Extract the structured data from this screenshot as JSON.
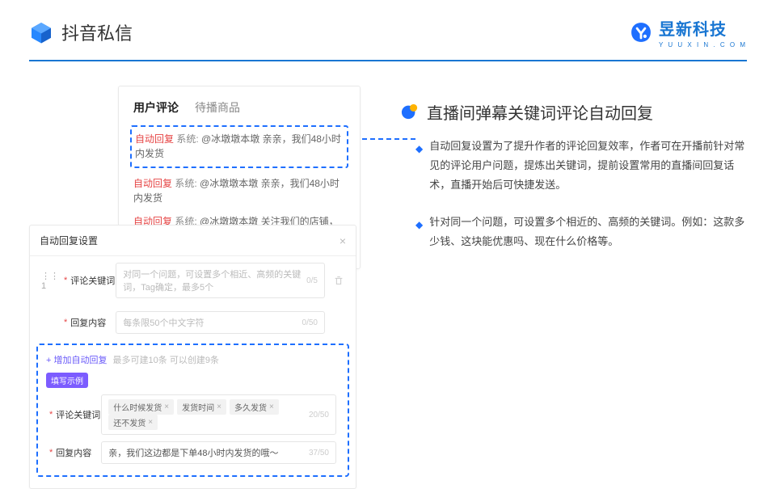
{
  "header": {
    "title": "抖音私信"
  },
  "brand": {
    "name": "昱新科技",
    "sub": "Y U U X I N . C O M"
  },
  "preview": {
    "tabs": {
      "active": "用户评论",
      "inactive": "待播商品"
    },
    "r1": {
      "tag": "自动回复",
      "sys": "系统:",
      "body": "@冰墩墩本墩 亲亲，我们48小时内发货"
    },
    "r2": {
      "tag": "自动回复",
      "sys": "系统:",
      "body": "@冰墩墩本墩 亲亲，我们48小时内发货"
    },
    "r3": {
      "tag": "自动回复",
      "sys": "系统:",
      "body": "@冰墩墩本墩 关注我们的店铺，每日都有热门推荐哟～"
    }
  },
  "settings": {
    "title": "自动回复设置",
    "row_num": "1",
    "kw_label": "评论关键词",
    "kw_placeholder": "对同一个问题，可设置多个相近、高频的关键词，Tag确定，最多5个",
    "kw_counter": "0/5",
    "reply_label": "回复内容",
    "reply_placeholder": "每条限50个中文字符",
    "reply_counter": "0/50",
    "add_label": "+ 增加自动回复",
    "add_hint": "最多可建10条 可以创建9条",
    "example_badge": "填写示例",
    "ex_kw_label": "评论关键词",
    "ex_tags": [
      "什么时候发货",
      "发货时间",
      "多久发货",
      "还不发货"
    ],
    "ex_kw_counter": "20/50",
    "ex_reply_label": "回复内容",
    "ex_reply_text": "亲，我们这边都是下单48小时内发货的哦～",
    "ex_reply_counter": "37/50"
  },
  "right": {
    "title": "直播间弹幕关键词评论自动回复",
    "b1": "自动回复设置为了提升作者的评论回复效率，作者可在开播前针对常见的评论用户问题，提炼出关键词，提前设置常用的直播间回复话术，直播开始后可快捷发送。",
    "b2": "针对同一个问题，可设置多个相近的、高频的关键词。例如：这款多少钱、这块能优惠吗、现在什么价格等。"
  }
}
